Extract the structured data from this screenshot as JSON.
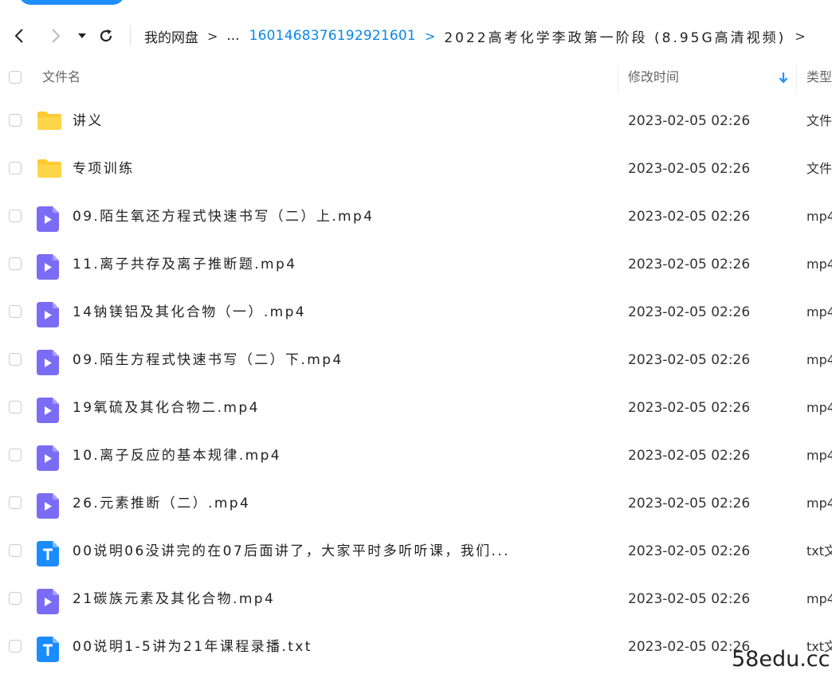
{
  "nav": {
    "breadcrumb": {
      "root": "我的网盘",
      "sep": ">",
      "ellipsis": "...",
      "link": "1601468376192921601",
      "current": "2022高考化学李政第一阶段 (8.95G高清视频)"
    }
  },
  "table": {
    "headers": {
      "name": "文件名",
      "modified": "修改时间",
      "type": "类型"
    },
    "rows": [
      {
        "icon": "folder-icon",
        "name": "讲义",
        "time": "2023-02-05 02:26",
        "type": "文件"
      },
      {
        "icon": "folder-icon",
        "name": "专项训练",
        "time": "2023-02-05 02:26",
        "type": "文件"
      },
      {
        "icon": "video-file-icon",
        "name": "09.陌生氧还方程式快速书写（二）上.mp4",
        "time": "2023-02-05 02:26",
        "type": "mp4"
      },
      {
        "icon": "video-file-icon",
        "name": "11.离子共存及离子推断题.mp4",
        "time": "2023-02-05 02:26",
        "type": "mp4"
      },
      {
        "icon": "video-file-icon",
        "name": "14钠镁铝及其化合物（一）.mp4",
        "time": "2023-02-05 02:26",
        "type": "mp4"
      },
      {
        "icon": "video-file-icon",
        "name": "09.陌生方程式快速书写（二）下.mp4",
        "time": "2023-02-05 02:26",
        "type": "mp4"
      },
      {
        "icon": "video-file-icon",
        "name": "19氧硫及其化合物二.mp4",
        "time": "2023-02-05 02:26",
        "type": "mp4"
      },
      {
        "icon": "video-file-icon",
        "name": "10.离子反应的基本规律.mp4",
        "time": "2023-02-05 02:26",
        "type": "mp4"
      },
      {
        "icon": "video-file-icon",
        "name": "26.元素推断（二）.mp4",
        "time": "2023-02-05 02:26",
        "type": "mp4"
      },
      {
        "icon": "text-file-icon",
        "name": "00说明06没讲完的在07后面讲了，大家平时多听听课，我们...",
        "time": "2023-02-05 02:26",
        "type": "txt文"
      },
      {
        "icon": "video-file-icon",
        "name": "21碳族元素及其化合物.mp4",
        "time": "2023-02-05 02:26",
        "type": "mp4"
      },
      {
        "icon": "text-file-icon",
        "name": "00说明1-5讲为21年课程录播.txt",
        "time": "2023-02-05 02:26",
        "type": "txt文"
      }
    ]
  },
  "watermark": "58edu.cc",
  "colors": {
    "accent": "#1f8fff",
    "link": "#0a87e6",
    "folder": "#ffc933",
    "video": "#7a6cf5",
    "text_file": "#1a8cff"
  }
}
